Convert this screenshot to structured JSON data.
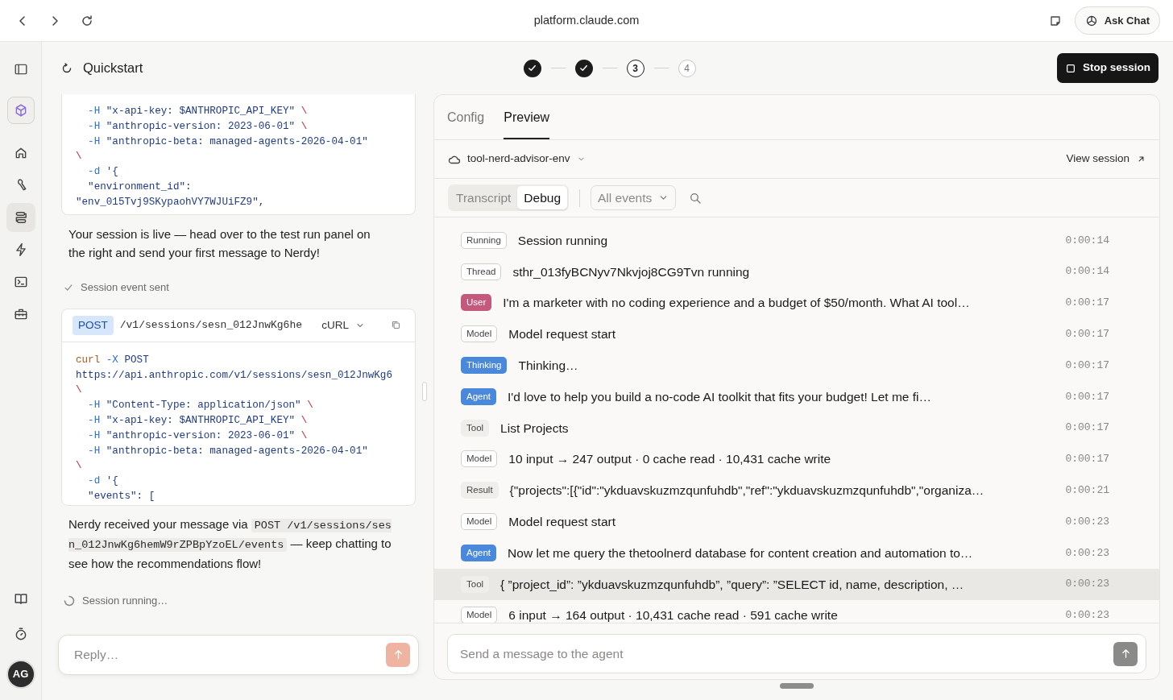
{
  "browser": {
    "url": "platform.claude.com",
    "ask_button": "Ask Chat"
  },
  "rail": {
    "items": [
      {
        "selected": false
      },
      {
        "selected": false
      },
      {
        "selected": false
      },
      {
        "selected": true
      },
      {
        "selected": false
      },
      {
        "selected": false
      },
      {
        "selected": false
      }
    ],
    "avatar": "AG"
  },
  "header": {
    "title": "Quickstart",
    "steps": [
      {
        "kind": "done"
      },
      {
        "kind": "done"
      },
      {
        "label": "3",
        "kind": "current"
      },
      {
        "label": "4",
        "kind": "upcoming"
      }
    ],
    "stop_button": "Stop session"
  },
  "left": {
    "code_block_1": {
      "lines": [
        [
          {
            "kind": "flag",
            "text": "  -H"
          },
          {
            "kind": "str",
            "text": " \"x-api-key: $ANTHROPIC_API_KEY\" "
          },
          {
            "kind": "esc",
            "text": "\\"
          }
        ],
        [
          {
            "kind": "flag",
            "text": "  -H"
          },
          {
            "kind": "str",
            "text": " \"anthropic-version: 2023-06-01\" "
          },
          {
            "kind": "esc",
            "text": "\\"
          }
        ],
        [
          {
            "kind": "flag",
            "text": "  -H"
          },
          {
            "kind": "str",
            "text": " \"anthropic-beta: managed-agents-2026-04-01\""
          }
        ],
        [
          {
            "kind": "esc",
            "text": "\\"
          }
        ],
        [
          {
            "kind": "flag",
            "text": "  -d"
          },
          {
            "kind": "str",
            "text": " '{"
          }
        ],
        [
          {
            "kind": "str",
            "text": "  \"environment_id\":"
          }
        ],
        [
          {
            "kind": "str",
            "text": "\"env_015Tvj9SKypaohVY7WJUiFZ9\","
          }
        ]
      ]
    },
    "message_1": "Your session is live — head over to the test run panel on the right and send your first message to Nerdy!",
    "status_1": {
      "kind": "done",
      "text": "Session event sent"
    },
    "code_block_2": {
      "method": "POST",
      "path": "/v1/sessions/sesn_012JnwKg6he",
      "language": "cURL",
      "lines": [
        [
          {
            "kind": "cmd",
            "text": "curl"
          },
          {
            "kind": "flag",
            "text": " -X"
          },
          {
            "kind": "str",
            "text": " POST"
          }
        ],
        [
          {
            "kind": "str",
            "text": "https://api.anthropic.com/v1/sessions/sesn_012JnwKg6"
          }
        ],
        [
          {
            "kind": "esc",
            "text": "\\"
          }
        ],
        [
          {
            "kind": "flag",
            "text": "  -H"
          },
          {
            "kind": "str",
            "text": " \"Content-Type: application/json\" "
          },
          {
            "kind": "esc",
            "text": "\\"
          }
        ],
        [
          {
            "kind": "flag",
            "text": "  -H"
          },
          {
            "kind": "str",
            "text": " \"x-api-key: $ANTHROPIC_API_KEY\" "
          },
          {
            "kind": "esc",
            "text": "\\"
          }
        ],
        [
          {
            "kind": "flag",
            "text": "  -H"
          },
          {
            "kind": "str",
            "text": " \"anthropic-version: 2023-06-01\" "
          },
          {
            "kind": "esc",
            "text": "\\"
          }
        ],
        [
          {
            "kind": "flag",
            "text": "  -H"
          },
          {
            "kind": "str",
            "text": " \"anthropic-beta: managed-agents-2026-04-01\""
          }
        ],
        [
          {
            "kind": "esc",
            "text": "\\"
          }
        ],
        [
          {
            "kind": "flag",
            "text": "  -d"
          },
          {
            "kind": "str",
            "text": " '{"
          }
        ],
        [
          {
            "kind": "str",
            "text": "  \"events\": ["
          }
        ]
      ]
    },
    "message_2": [
      {
        "kind": "text",
        "text": "Nerdy received your message via "
      },
      {
        "kind": "code",
        "text": "POST /v1/sessions/sesn_012JnwKg6hemW9rZPBpYzoEL/events"
      },
      {
        "kind": "text",
        "text": " — keep chatting to see how the recommendations flow!"
      }
    ],
    "status_2": {
      "kind": "running",
      "text": "Session running…"
    },
    "reply": {
      "placeholder": "Reply…",
      "disabled": true
    }
  },
  "preview": {
    "tabs": [
      {
        "label": "Config",
        "selected": false
      },
      {
        "label": "Preview",
        "selected": true
      }
    ],
    "environment": "tool-nerd-advisor-env",
    "view_session": "View session",
    "modes": [
      {
        "label": "Transcript",
        "selected": false
      },
      {
        "label": "Debug",
        "selected": true
      }
    ],
    "filter": "All events",
    "events": [
      {
        "badge": "Running",
        "kind": "outline",
        "text": "Session running",
        "time": "0:00:14",
        "selected": false
      },
      {
        "badge": "Thread",
        "kind": "outline",
        "text": "sthr_013fyBCNyv7Nkvjoj8CG9Tvn running",
        "time": "0:00:14",
        "selected": false
      },
      {
        "badge": "User",
        "kind": "filled",
        "color": "#c4597c",
        "text": "I'm a marketer with no coding experience and a budget of $50/month. What AI tool…",
        "time": "0:00:17",
        "selected": false
      },
      {
        "badge": "Model",
        "kind": "outline",
        "text": "Model request start",
        "time": "0:00:17",
        "selected": false
      },
      {
        "badge": "Thinking",
        "kind": "filled",
        "color": "#4a88dc",
        "text": "Thinking…",
        "time": "0:00:17",
        "selected": false
      },
      {
        "badge": "Agent",
        "kind": "filled",
        "color": "#4a88dc",
        "text": "I'd love to help you build a no-code AI toolkit that fits your budget! Let me fi…",
        "time": "0:00:17",
        "selected": false
      },
      {
        "badge": "Tool",
        "kind": "muted",
        "text": "List Projects",
        "time": "0:00:17",
        "selected": false
      },
      {
        "badge": "Model",
        "kind": "outline",
        "text": "10 input → 247 output · 0 cache read · 10,431 cache write",
        "time": "0:00:17",
        "selected": false
      },
      {
        "badge": "Result",
        "kind": "muted",
        "text": "{\"projects\":[{\"id\":\"ykduavskuzmzqunfuhdb\",\"ref\":\"ykduavskuzmzqunfuhdb\",\"organiza…",
        "time": "0:00:21",
        "selected": false
      },
      {
        "badge": "Model",
        "kind": "outline",
        "text": "Model request start",
        "time": "0:00:23",
        "selected": false
      },
      {
        "badge": "Agent",
        "kind": "filled",
        "color": "#4a88dc",
        "text": "Now let me query the thetoolnerd database for content creation and automation to…",
        "time": "0:00:23",
        "selected": false
      },
      {
        "badge": "Tool",
        "kind": "muted",
        "text": "{ ”project_id”: ”ykduavskuzmzqunfuhdb”, ”query”: ”SELECT id, name, description, …",
        "time": "0:00:23",
        "selected": true
      },
      {
        "badge": "Model",
        "kind": "outline",
        "text": "6 input → 164 output · 10,431 cache read · 591 cache write",
        "time": "0:00:23",
        "selected": false
      }
    ],
    "composer": {
      "placeholder": "Send a message to the agent"
    }
  }
}
